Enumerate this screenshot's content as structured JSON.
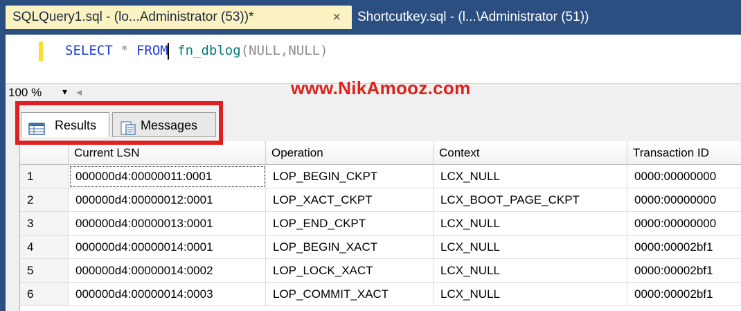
{
  "tabs": {
    "active_label": "SQLQuery1.sql - (lo...Administrator (53))*",
    "close_glyph": "×",
    "inactive_label": "Shortcutkey.sql - (l...\\Administrator (51))"
  },
  "editor": {
    "kw_select": "SELECT",
    "op_star": " * ",
    "kw_from": "FROM",
    "fn_name": " fn_dblog",
    "open_paren": "(",
    "arg1": "NULL",
    "comma": ",",
    "arg2": "NULL",
    "close_paren": ")"
  },
  "zoom": {
    "value": "100 %",
    "arrow": "▾",
    "scroll": "◂"
  },
  "watermark": "www.NikAmooz.com",
  "result_tabs": {
    "results": "Results",
    "messages": "Messages"
  },
  "grid": {
    "columns": [
      "",
      "Current LSN",
      "Operation",
      "Context",
      "Transaction ID"
    ],
    "rows": [
      [
        "1",
        "000000d4:00000011:0001",
        "LOP_BEGIN_CKPT",
        "LCX_NULL",
        "0000:00000000"
      ],
      [
        "2",
        "000000d4:00000012:0001",
        "LOP_XACT_CKPT",
        "LCX_BOOT_PAGE_CKPT",
        "0000:00000000"
      ],
      [
        "3",
        "000000d4:00000013:0001",
        "LOP_END_CKPT",
        "LCX_NULL",
        "0000:00000000"
      ],
      [
        "4",
        "000000d4:00000014:0001",
        "LOP_BEGIN_XACT",
        "LCX_NULL",
        "0000:00002bf1"
      ],
      [
        "5",
        "000000d4:00000014:0002",
        "LOP_LOCK_XACT",
        "LCX_NULL",
        "0000:00002bf1"
      ],
      [
        "6",
        "000000d4:00000014:0003",
        "LOP_COMMIT_XACT",
        "LCX_NULL",
        "0000:00002bf1"
      ]
    ]
  },
  "colors": {
    "accent_dark": "#2b4f80",
    "active_tab": "#fbf2c1",
    "highlight_red": "#e02020"
  }
}
